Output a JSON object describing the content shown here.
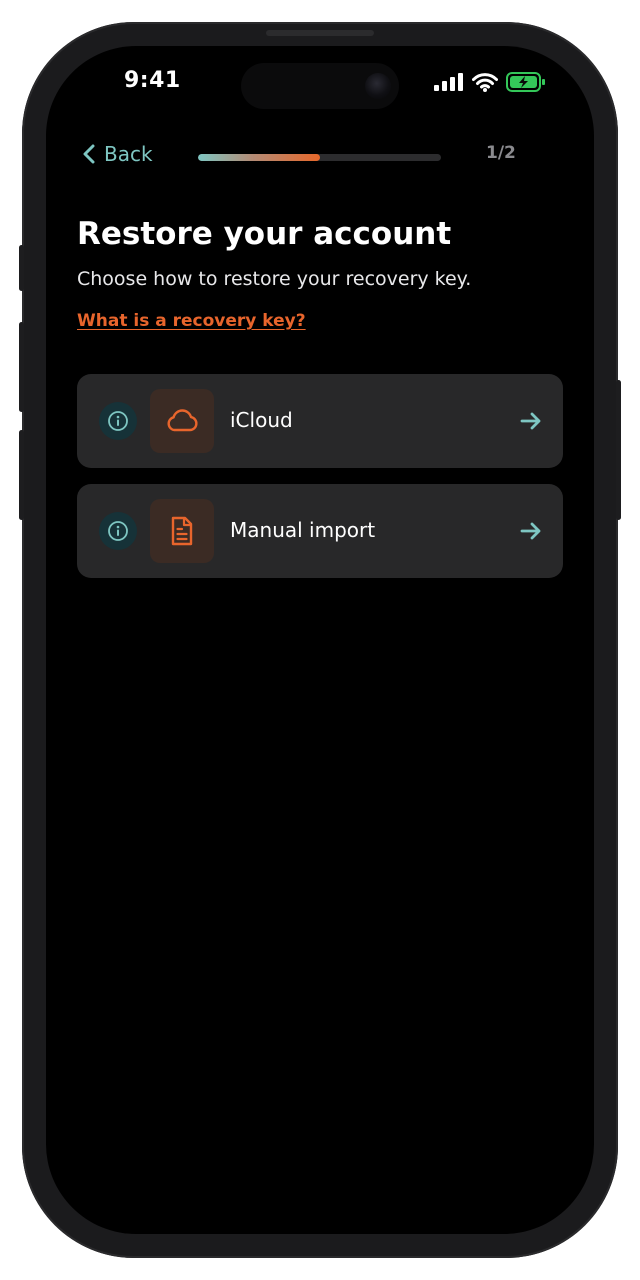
{
  "status_bar": {
    "time": "9:41"
  },
  "nav": {
    "back_label": "Back",
    "step_indicator": "1/2",
    "progress_fraction": 0.5
  },
  "content": {
    "title": "Restore your account",
    "subtitle": "Choose how to restore your recovery key.",
    "help_link": "What is a recovery key?"
  },
  "options": [
    {
      "label": "iCloud",
      "icon": "cloud-icon"
    },
    {
      "label": "Manual import",
      "icon": "document-icon"
    }
  ],
  "colors": {
    "background": "#000000",
    "card": "#282829",
    "accent_teal": "#7ec6c2",
    "accent_orange": "#e8652c",
    "battery_green": "#34c759"
  }
}
